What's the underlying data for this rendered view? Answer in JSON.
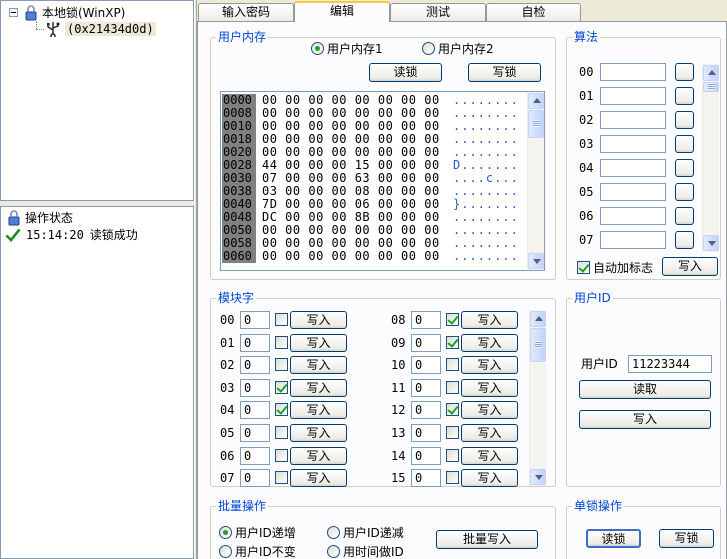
{
  "tree": {
    "root_label": "本地锁(WinXP)",
    "child_label": "(0x21434d0d)"
  },
  "status_pane": {
    "header": "操作状态",
    "log": [
      {
        "time": "15:14:20",
        "message": "读锁成功"
      }
    ]
  },
  "tabs": [
    {
      "label": "输入密码",
      "active": false
    },
    {
      "label": "编辑",
      "active": true
    },
    {
      "label": "测试",
      "active": false
    },
    {
      "label": "自检",
      "active": false
    }
  ],
  "user_memory": {
    "title": "用户内存",
    "radio_1": "用户内存1",
    "radio_2": "用户内存2",
    "selected": "用户内存1",
    "read_label": "读锁",
    "write_label": "写锁",
    "rows": [
      {
        "addr": "0000",
        "bytes": "00 00 00 00 00 00 00 00",
        "ascii": "........"
      },
      {
        "addr": "0008",
        "bytes": "00 00 00 00 00 00 00 00",
        "ascii": "........"
      },
      {
        "addr": "0010",
        "bytes": "00 00 00 00 00 00 00 00",
        "ascii": "........"
      },
      {
        "addr": "0018",
        "bytes": "00 00 00 00 00 00 00 00",
        "ascii": "........"
      },
      {
        "addr": "0020",
        "bytes": "00 00 00 00 00 00 00 00",
        "ascii": "........"
      },
      {
        "addr": "0028",
        "bytes": "44 00 00 00 15 00 00 00",
        "ascii": "D......."
      },
      {
        "addr": "0030",
        "bytes": "07 00 00 00 63 00 00 00",
        "ascii": "....c..."
      },
      {
        "addr": "0038",
        "bytes": "03 00 00 00 08 00 00 00",
        "ascii": "........"
      },
      {
        "addr": "0040",
        "bytes": "7D 00 00 00 06 00 00 00",
        "ascii": "}......."
      },
      {
        "addr": "0048",
        "bytes": "DC 00 00 00 8B 00 00 00",
        "ascii": "........"
      },
      {
        "addr": "0050",
        "bytes": "00 00 00 00 00 00 00 00",
        "ascii": "........"
      },
      {
        "addr": "0058",
        "bytes": "00 00 00 00 00 00 00 00",
        "ascii": "........"
      },
      {
        "addr": "0060",
        "bytes": "00 00 00 00 00 00 00 00",
        "ascii": "........"
      }
    ]
  },
  "algorithm": {
    "title": "算法",
    "rows": [
      "00",
      "01",
      "02",
      "03",
      "04",
      "05",
      "06",
      "07"
    ],
    "auto_flag_label": "自动加标志",
    "auto_flag_checked": true,
    "write_label": "写入"
  },
  "modules": {
    "title": "模块字",
    "write_label": "写入",
    "left": [
      {
        "id": "00",
        "value": "0",
        "checked": false
      },
      {
        "id": "01",
        "value": "0",
        "checked": false
      },
      {
        "id": "02",
        "value": "0",
        "checked": false
      },
      {
        "id": "03",
        "value": "0",
        "checked": true
      },
      {
        "id": "04",
        "value": "0",
        "checked": true
      },
      {
        "id": "05",
        "value": "0",
        "checked": false
      },
      {
        "id": "06",
        "value": "0",
        "checked": false
      },
      {
        "id": "07",
        "value": "0",
        "checked": false
      }
    ],
    "right": [
      {
        "id": "08",
        "value": "0",
        "checked": true
      },
      {
        "id": "09",
        "value": "0",
        "checked": true
      },
      {
        "id": "10",
        "value": "0",
        "checked": false
      },
      {
        "id": "11",
        "value": "0",
        "checked": false
      },
      {
        "id": "12",
        "value": "0",
        "checked": true
      },
      {
        "id": "13",
        "value": "0",
        "checked": false
      },
      {
        "id": "14",
        "value": "0",
        "checked": false
      },
      {
        "id": "15",
        "value": "0",
        "checked": false
      }
    ]
  },
  "user_id": {
    "title": "用户ID",
    "field_label": "用户ID",
    "value": "11223344",
    "read_label": "读取",
    "write_label": "写入"
  },
  "batch": {
    "title": "批量操作",
    "opt_increment": "用户ID递增",
    "opt_decrement": "用户ID递减",
    "opt_unchanged": "用户ID不变",
    "opt_time": "用时间做ID",
    "selected": "用户ID递增",
    "batch_write_label": "批量写入"
  },
  "single_lock": {
    "title": "单锁操作",
    "read_label": "读锁",
    "write_label": "写锁"
  }
}
